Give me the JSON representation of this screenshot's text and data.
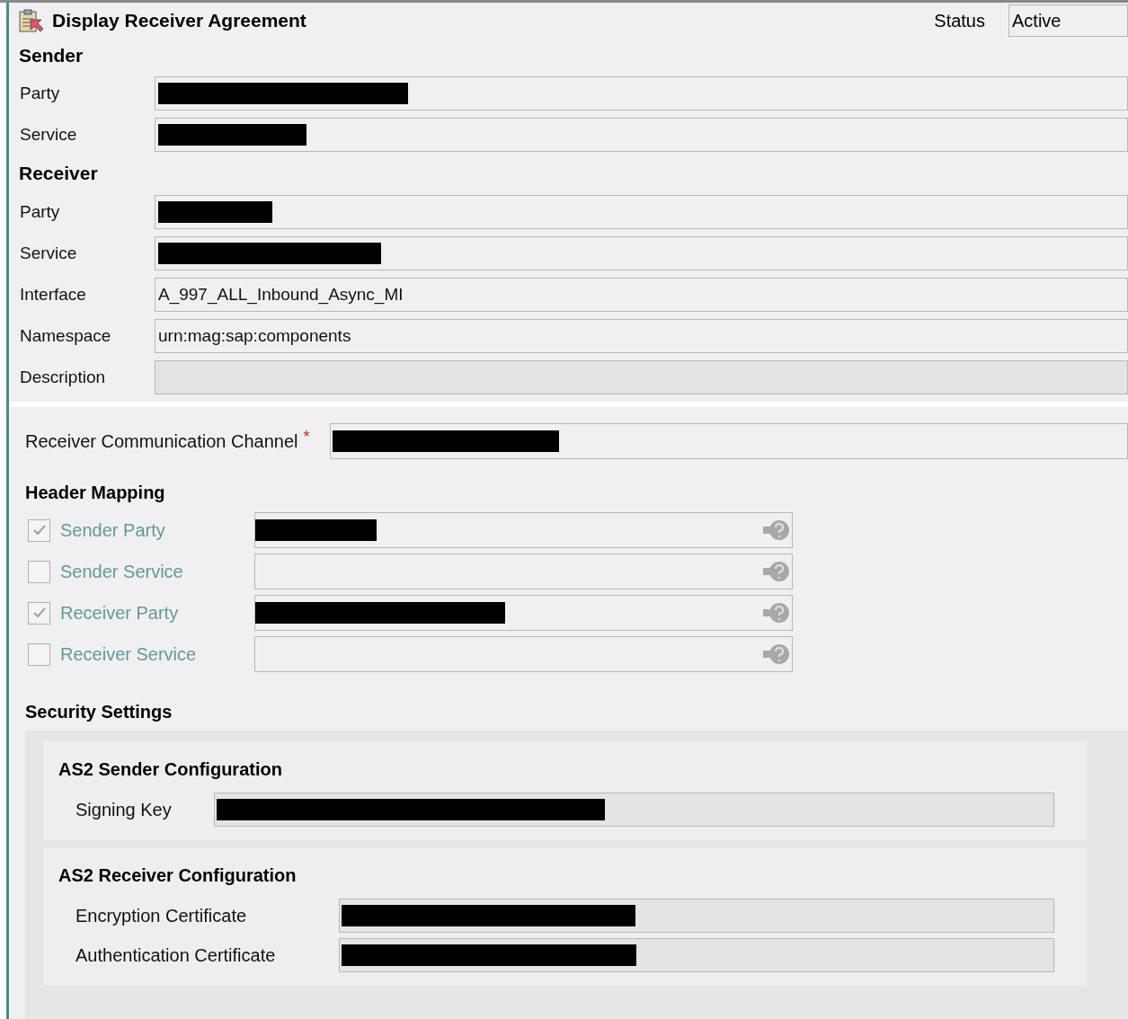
{
  "window": {
    "title": "Display Receiver Agreement",
    "status_label": "Status",
    "status_value": "Active"
  },
  "sender": {
    "heading": "Sender",
    "fields": [
      {
        "label": "Party",
        "redacted": true
      },
      {
        "label": "Service",
        "redacted": true
      }
    ]
  },
  "receiver": {
    "heading": "Receiver",
    "fields": [
      {
        "label": "Party",
        "redacted": true
      },
      {
        "label": "Service",
        "redacted": true
      },
      {
        "label": "Interface",
        "value": "A_997_ALL_Inbound_Async_MI",
        "redacted": false
      },
      {
        "label": "Namespace",
        "value": "urn:mag:sap:components",
        "redacted": false
      },
      {
        "label": "Description",
        "redacted": false
      }
    ]
  },
  "channel": {
    "label": "Receiver Communication Channel",
    "required_mark": "*",
    "redacted": true
  },
  "header_mapping": {
    "heading": "Header Mapping",
    "rows": [
      {
        "label": "Sender Party",
        "checked": true,
        "redacted": true
      },
      {
        "label": "Sender Service",
        "checked": false,
        "redacted": false
      },
      {
        "label": "Receiver Party",
        "checked": true,
        "redacted": true
      },
      {
        "label": "Receiver Service",
        "checked": false,
        "redacted": false
      }
    ]
  },
  "security": {
    "heading": "Security Settings",
    "groups": [
      {
        "title": "AS2 Sender Configuration",
        "fields": [
          {
            "label": "Signing Key",
            "redacted": true
          }
        ]
      },
      {
        "title": "AS2 Receiver Configuration",
        "fields": [
          {
            "label": "Encryption Certificate",
            "redacted": true
          },
          {
            "label": "Authentication Certificate",
            "redacted": true
          }
        ]
      }
    ]
  }
}
